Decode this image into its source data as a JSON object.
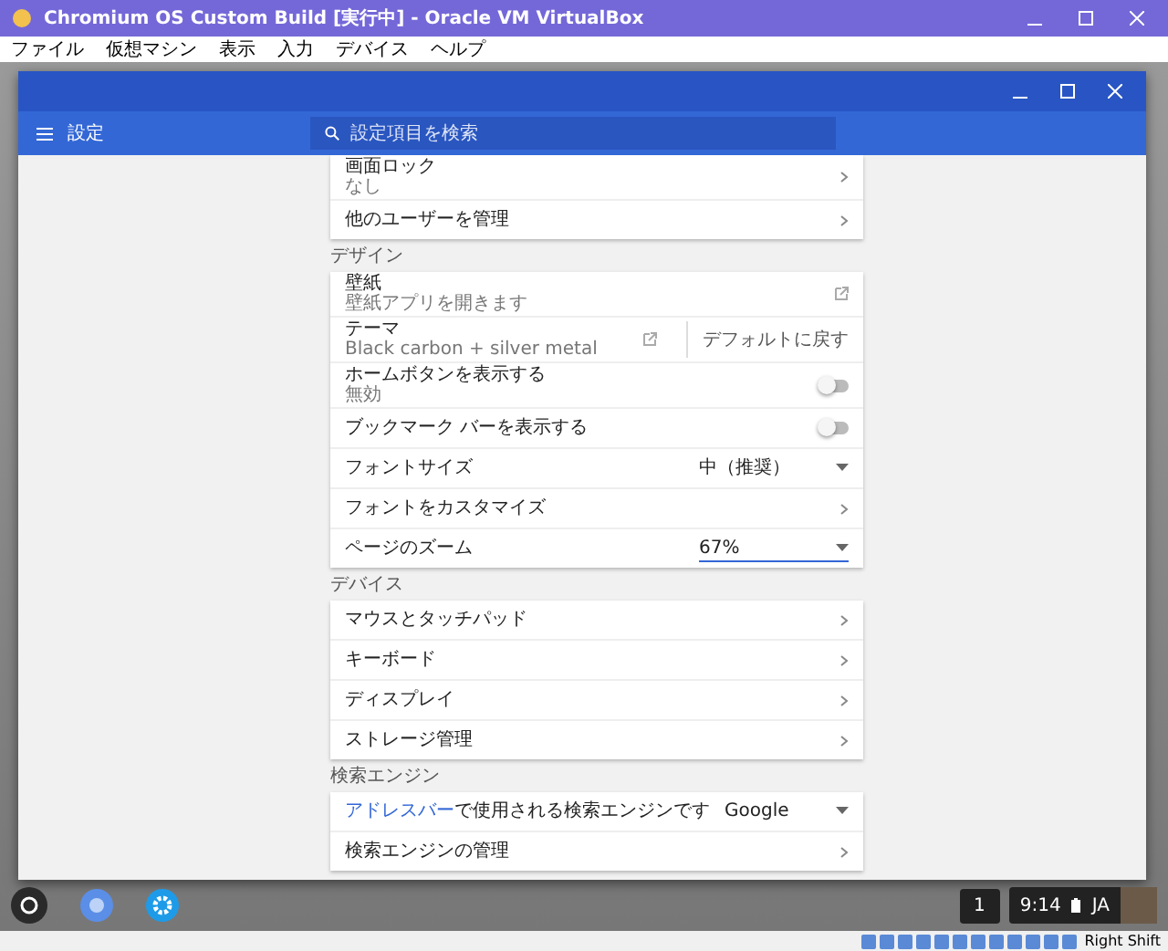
{
  "window": {
    "title": "Chromium OS Custom Build [実行中] - Oracle VM VirtualBox"
  },
  "menu": [
    "ファイル",
    "仮想マシン",
    "表示",
    "入力",
    "デバイス",
    "ヘルプ"
  ],
  "app": {
    "title": "設定",
    "search": {
      "placeholder": "設定項目を検索"
    }
  },
  "sections": [
    {
      "rows": [
        {
          "kind": "link",
          "label": "画面ロック",
          "sub": "なし"
        },
        {
          "kind": "link",
          "label": "他のユーザーを管理"
        }
      ]
    },
    {
      "title": "デザイン",
      "rows": [
        {
          "kind": "external",
          "label": "壁紙",
          "sub": "壁紙アプリを開きます"
        },
        {
          "kind": "theme",
          "label": "テーマ",
          "sub": "Black carbon + silver metal",
          "button": "デフォルトに戻す"
        },
        {
          "kind": "toggle",
          "label": "ホームボタンを表示する",
          "sub": "無効",
          "on": false
        },
        {
          "kind": "toggle",
          "label": "ブックマーク バーを表示する",
          "on": false
        },
        {
          "kind": "select",
          "label": "フォントサイズ",
          "value": "中（推奨）",
          "focused": false
        },
        {
          "kind": "link",
          "label": "フォントをカスタマイズ"
        },
        {
          "kind": "select",
          "label": "ページのズーム",
          "value": "67%",
          "focused": true
        }
      ]
    },
    {
      "title": "デバイス",
      "rows": [
        {
          "kind": "link",
          "label": "マウスとタッチパッド"
        },
        {
          "kind": "link",
          "label": "キーボード"
        },
        {
          "kind": "link",
          "label": "ディスプレイ"
        },
        {
          "kind": "link",
          "label": "ストレージ管理"
        }
      ]
    },
    {
      "title": "検索エンジン",
      "rows": [
        {
          "kind": "select",
          "label": "**アドレスバー**で使用される検索エンジンです",
          "value": "Google",
          "focused": false
        },
        {
          "kind": "link",
          "label": "検索エンジンの管理"
        }
      ]
    }
  ],
  "shelf": {
    "badge": "1",
    "time": "9:14",
    "ime": "JA"
  },
  "status_bar": {
    "host_key": "Right Shift"
  }
}
